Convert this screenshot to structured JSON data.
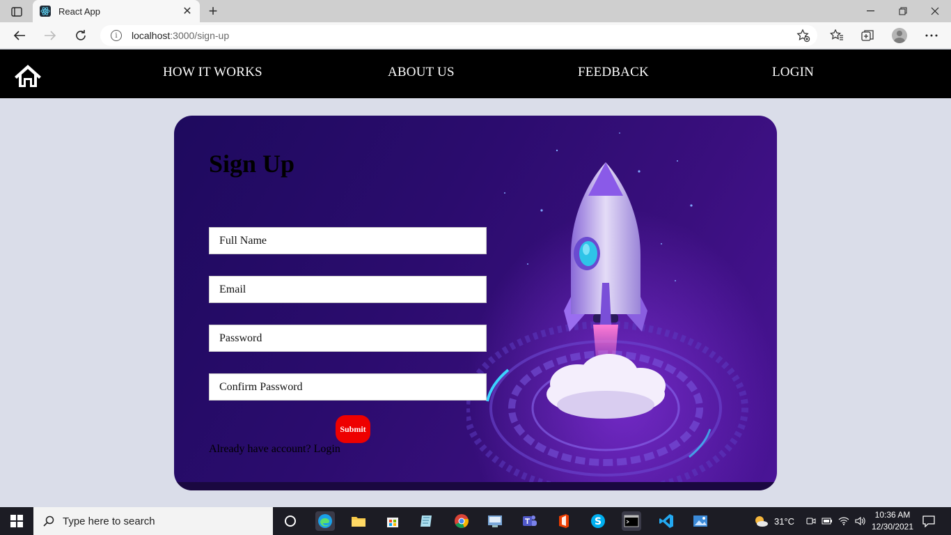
{
  "browser": {
    "tab_title": "React App",
    "url_host": "localhost",
    "url_rest": ":3000/sign-up"
  },
  "nav": {
    "items": [
      {
        "label": "HOW IT WORKS"
      },
      {
        "label": "ABOUT US"
      },
      {
        "label": "FEEDBACK"
      },
      {
        "label": "LOGIN"
      }
    ]
  },
  "form": {
    "heading": "Sign Up",
    "fields": [
      {
        "placeholder": "Full Name"
      },
      {
        "placeholder": "Email"
      },
      {
        "placeholder": "Password"
      },
      {
        "placeholder": "Confirm Password"
      }
    ],
    "submit_label": "Submit",
    "already_text": "Already have account?",
    "login_link": "Login"
  },
  "taskbar": {
    "search_placeholder": "Type here to search",
    "weather": "31°C",
    "time": "10:36 AM",
    "date": "12/30/2021"
  },
  "colors": {
    "nav_bg": "#000000",
    "page_bg": "#dadde9",
    "card_bg": "#2b0c6e",
    "submit_bg": "#ee0000"
  }
}
